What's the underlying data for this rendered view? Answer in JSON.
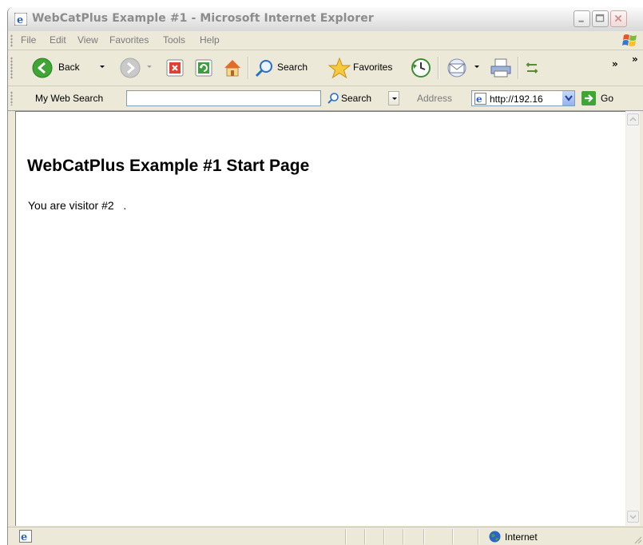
{
  "window": {
    "title": "WebCatPlus Example #1 - Microsoft Internet Explorer"
  },
  "menu": {
    "items": [
      "File",
      "Edit",
      "View",
      "Favorites",
      "Tools",
      "Help"
    ]
  },
  "toolbar": {
    "back_label": "Back",
    "search_label": "Search",
    "favorites_label": "Favorites",
    "more_chevron": "»"
  },
  "addressbar": {
    "web_search_label": "My Web Search",
    "web_search_value": "",
    "search_button_label": "Search",
    "address_label": "Address",
    "url": "http://192.16",
    "go_label": "Go"
  },
  "page": {
    "heading": "WebCatPlus Example #1 Start Page",
    "visitor_text": "You are visitor #2   ."
  },
  "status": {
    "zone": "Internet"
  },
  "colors": {
    "chrome": "#ECE9D8",
    "accent_blue": "#2F6FD6",
    "close_red": "#C75050"
  }
}
